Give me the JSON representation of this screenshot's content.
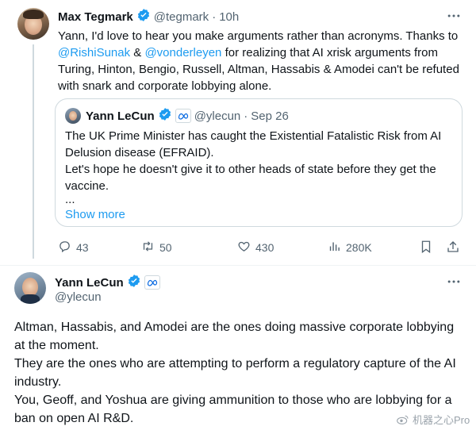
{
  "tweet1": {
    "author_name": "Max Tegmark",
    "handle": "@tegmark",
    "separator": "·",
    "time": "10h",
    "text_pre": "Yann, I'd love to hear you make arguments rather than acronyms. Thanks to ",
    "mention1": "@RishiSunak",
    "text_mid": " & ",
    "mention2": "@vonderleyen",
    "text_post": " for realizing that AI xrisk arguments  from Turing, Hinton, Bengio, Russell, Altman, Hassabis & Amodei can't be refuted with snark and corporate lobbying alone.",
    "quote": {
      "author_name": "Yann LeCun",
      "handle": "@ylecun",
      "separator": "·",
      "date": "Sep 26",
      "line1": "The UK Prime Minister has caught the Existential Fatalistic Risk from AI Delusion disease (EFRAID).",
      "line2": "Let's hope he doesn't give it to other heads of state before they get the vaccine.",
      "ellipsis": "...",
      "show_more": "Show more"
    },
    "actions": {
      "replies": "43",
      "retweets": "50",
      "likes": "430",
      "views": "280K"
    }
  },
  "tweet2": {
    "author_name": "Yann LeCun",
    "handle": "@ylecun",
    "text_line1": "Altman, Hassabis, and Amodei are the ones doing massive corporate lobbying at the moment.",
    "text_line2": "They are the ones who are attempting to perform a regulatory capture of the AI industry.",
    "text_line3": "You, Geoff, and Yoshua are giving ammunition to those who are lobbying for a ban on open AI R&D."
  },
  "watermark": "机器之心Pro",
  "colors": {
    "verified_blue": "#1d9bf0",
    "link_blue": "#1d9bf0",
    "muted_gray": "#536471",
    "meta_blue": "#0668E1"
  },
  "icons": [
    "more-icon",
    "verified-badge-icon",
    "meta-affiliation-icon",
    "reply-icon",
    "retweet-icon",
    "like-icon",
    "views-icon",
    "bookmark-icon",
    "share-icon"
  ]
}
